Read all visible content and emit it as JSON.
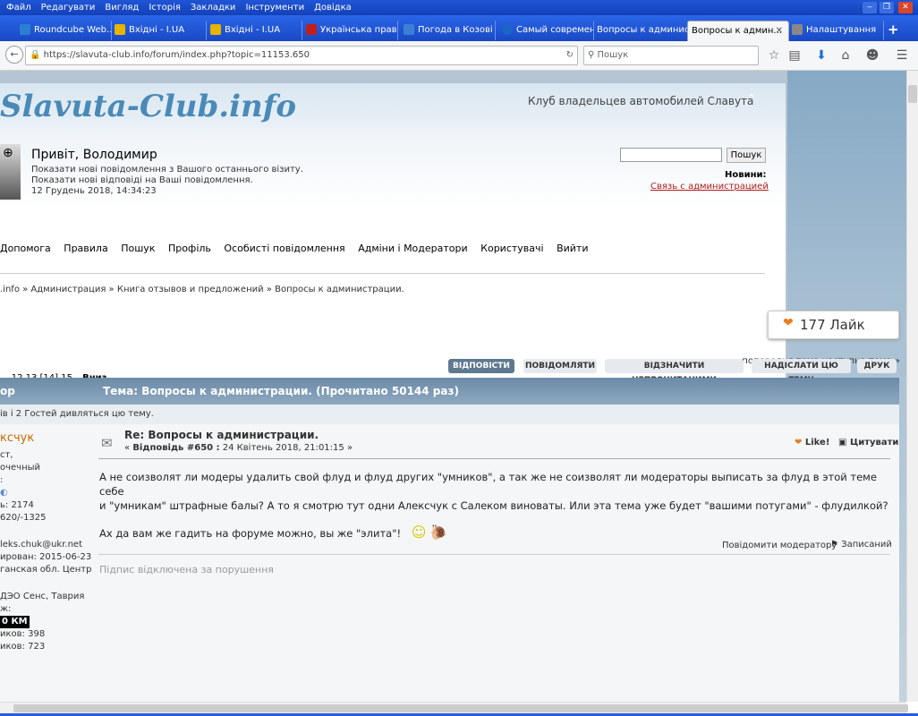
{
  "menu": [
    "Файл",
    "Редагувати",
    "Вигляд",
    "Історія",
    "Закладки",
    "Інструменти",
    "Довідка"
  ],
  "tabs": [
    {
      "label": "Roundcube Web...",
      "color": "#2a7fd4"
    },
    {
      "label": "Вхідні - I.UA",
      "color": "#e7b400"
    },
    {
      "label": "Вхідні - I.UA",
      "color": "#e7b400"
    },
    {
      "label": "Українська прав...",
      "color": "#c0201a"
    },
    {
      "label": "Погода в Козові",
      "color": "#3c80d6"
    },
    {
      "label": "Самый современ...",
      "color": "#1d64c8"
    },
    {
      "label": "Вопросы к администр...",
      "color": "#ffffff"
    },
    {
      "label": "Вопросы к админ...",
      "color": "#ffffff"
    },
    {
      "label": "Налаштування",
      "color": "#888888"
    }
  ],
  "url": "https://slavuta-club.info/forum/index.php?topic=11153.650",
  "search_placeholder": "Пошук",
  "site": {
    "logo": "Slavuta-Club.info",
    "slogan": "Клуб владельцев автомобилей Славута",
    "greeting": "Привіт, Володимир",
    "new_since": "Показати нові повідомлення з Вашого останнього візиту.",
    "new_replies": "Показати нові відповіді на Ваші повідомлення.",
    "datetime": "12 Грудень 2018, 14:34:23",
    "search_button": "Пошук",
    "news_label": "Новини:",
    "news_link": "Связь с администрацией",
    "nav": [
      "Допомога",
      "Правила",
      "Пошук",
      "Профіль",
      "Особисті повідомлення",
      "Адміни і Модератори",
      "Користувачі",
      "Вийти"
    ],
    "breadcrumb": ".info » Администрация » Книга отзывов и предложений » Вопросы к администрации.",
    "likes": "177 Лайк",
    "prev_next": "« попередня тема наступна тема »",
    "pages": "... 12 13 [14] 15",
    "down": "Вниз",
    "buttons": [
      "ВІДПОВІСТИ",
      "ПОВІДОМЛЯТИ",
      "ВІДЗНАЧИТИ НЕПРОЧИТАНИМИ",
      "НАДІСЛАТИ ЦЮ ТЕМУ",
      "ДРУК"
    ],
    "author_col": "ор",
    "topic_title": "Тема: Вопросы к администрации.  (Прочитано 50144 раз)",
    "viewers": "ів і 2 Гостей дивляться цю тему."
  },
  "post": {
    "author": "ксчук",
    "author_lines": [
      "ст,",
      "очечный",
      ":"
    ],
    "stats": [
      "ь: 2174",
      "620/-1325"
    ],
    "email": "leks.chuk@ukr.net",
    "registered": "ирован: 2015-06-23",
    "location": "ганская обл. Центр",
    "cars": "ДЭО Сенс, Таврия",
    "mileage_label": "ж:",
    "mileage": "0 КМ",
    "thanks1": "иков: 398",
    "thanks2": "иков: 723",
    "title": "Re: Вопросы к администрации.",
    "reply_meta_prefix": "«",
    "reply_num": "Відповідь #650 :",
    "reply_date": "24 Квітень 2018, 21:01:15 »",
    "like": "Like!",
    "quote": "Цитувати",
    "body1": "А не соизволят ли модеры удалить свой флуд и флуд других \"умников\", а так же не соизволят ли модераторы выписать за флуд в этой теме себе",
    "body2": "и \"умникам\" штрафные балы? А то я смотрю тут одни Алексчук с Салеком виноваты. Или эта тема уже будет \"вашими потугами\" - флудилкой?",
    "body3": "Ах да вам же гадить на форуме можно, вы же \"элита\"!",
    "report": "Повідомити модератору",
    "logged": "Записаний",
    "signature": "Підпис відключена за порушення"
  }
}
